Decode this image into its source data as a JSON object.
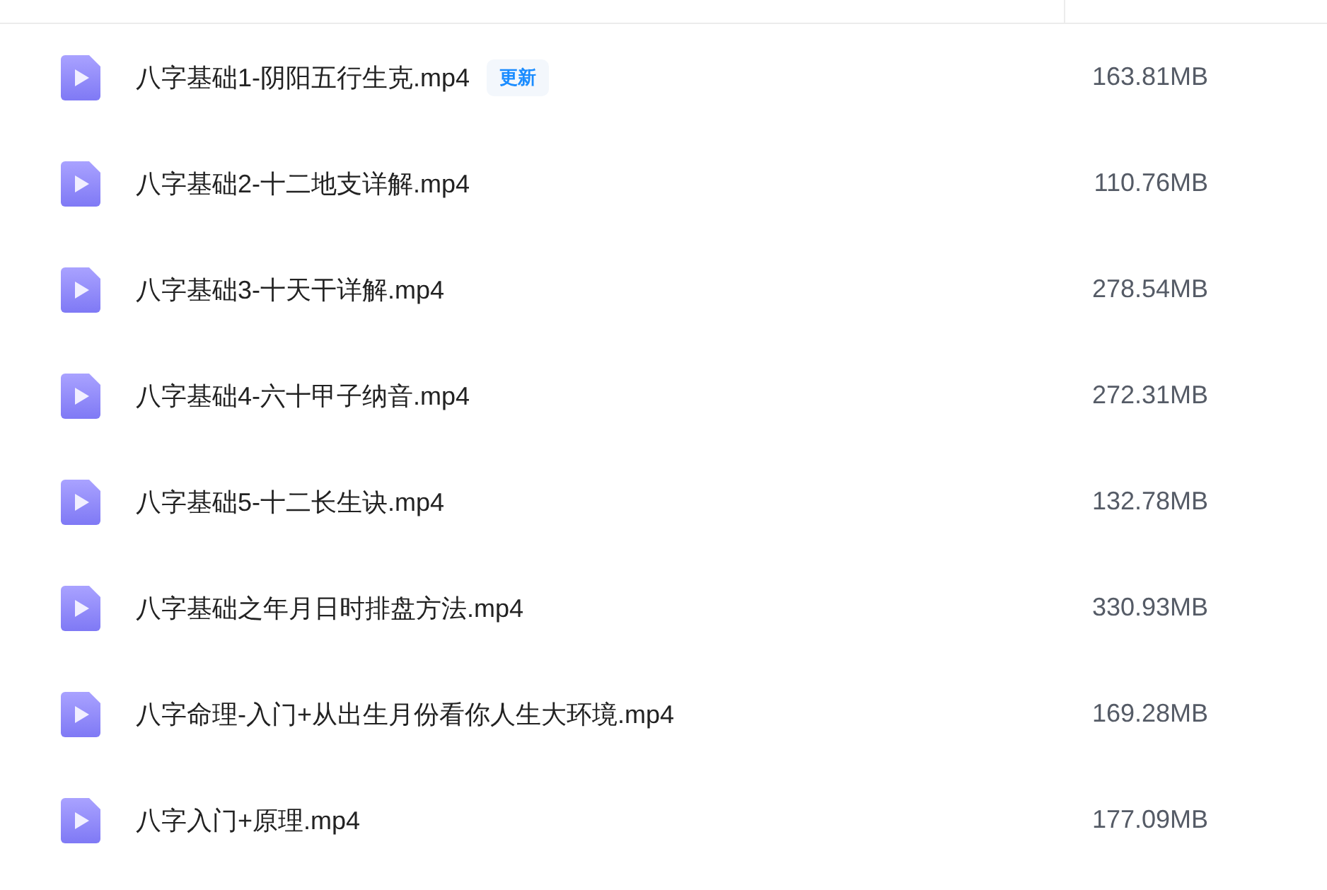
{
  "files": [
    {
      "name": "八字基础1-阴阳五行生克.mp4",
      "badge": "更新",
      "size": "163.81MB"
    },
    {
      "name": "八字基础2-十二地支详解.mp4",
      "size": "110.76MB"
    },
    {
      "name": "八字基础3-十天干详解.mp4",
      "size": "278.54MB"
    },
    {
      "name": "八字基础4-六十甲子纳音.mp4",
      "size": "272.31MB"
    },
    {
      "name": "八字基础5-十二长生诀.mp4",
      "size": "132.78MB"
    },
    {
      "name": "八字基础之年月日时排盘方法.mp4",
      "size": "330.93MB"
    },
    {
      "name": "八字命理-入门+从出生月份看你人生大环境.mp4",
      "size": "169.28MB"
    },
    {
      "name": "八字入门+原理.mp4",
      "size": "177.09MB"
    }
  ]
}
